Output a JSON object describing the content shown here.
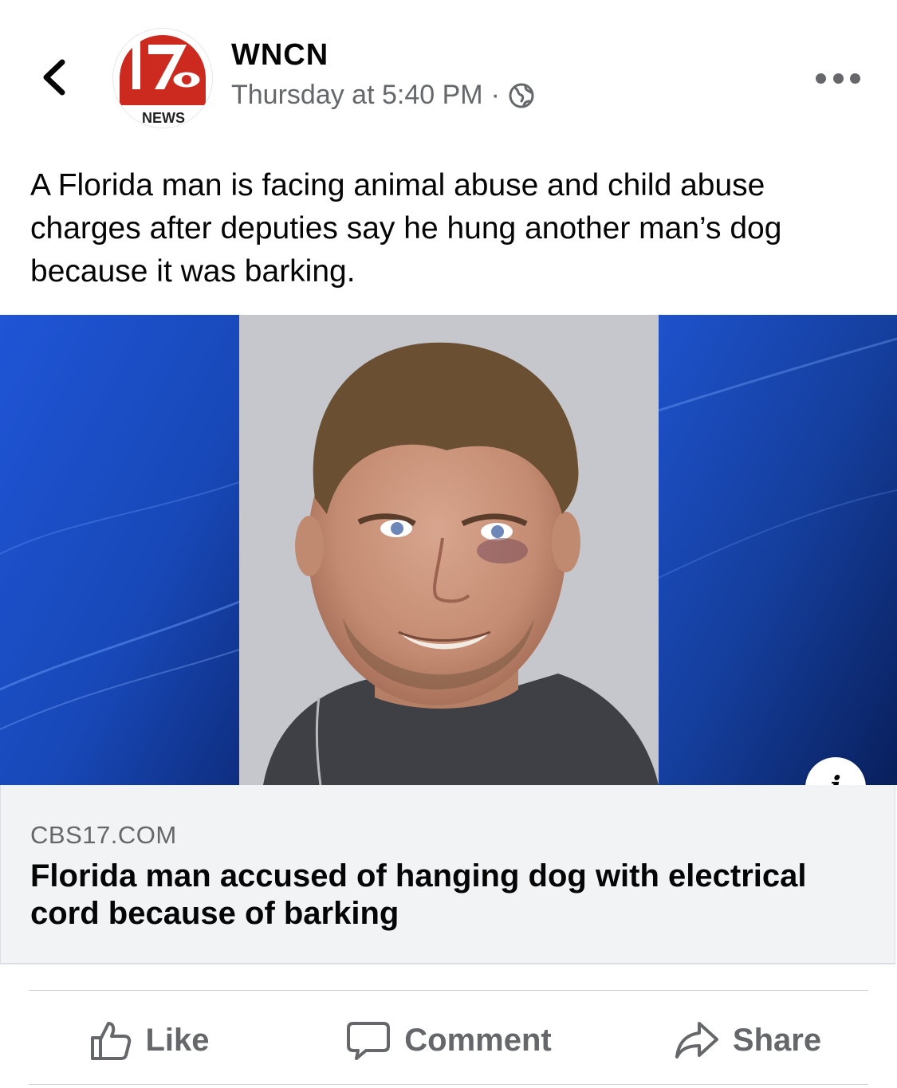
{
  "post": {
    "page_name": "WNCN",
    "timestamp": "Thursday at 5:40 PM",
    "separator": "·",
    "audience_icon": "globe-icon",
    "text": "A Florida man is facing animal abuse and child abuse charges after deputies say he hung another man’s dog because it was barking.",
    "avatar": {
      "logo_number": "17",
      "logo_word": "NEWS",
      "colors": {
        "red": "#cc2a1f",
        "white": "#ffffff"
      }
    }
  },
  "link_preview": {
    "domain": "CBS17.COM",
    "headline": "Florida man accused of hanging dog with electrical cord because of barking",
    "info_label": "i"
  },
  "actions": [
    {
      "label": "Like",
      "icon": "thumbs-up-icon"
    },
    {
      "label": "Comment",
      "icon": "comment-bubble-icon"
    },
    {
      "label": "Share",
      "icon": "share-arrow-icon"
    }
  ],
  "colors": {
    "secondary_text": "#65676b",
    "primary_text": "#050505",
    "preview_bg": "#f2f3f5",
    "photo_blue": "#1b45b8"
  }
}
